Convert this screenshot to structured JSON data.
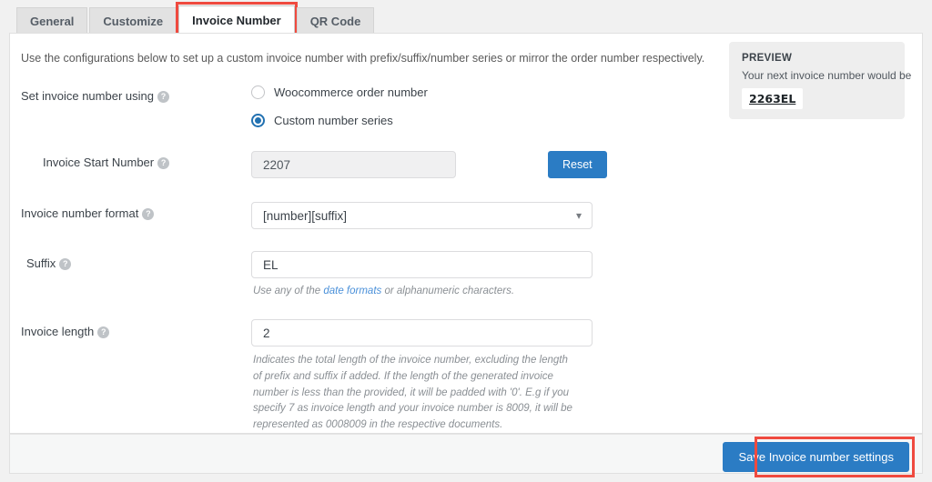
{
  "tabs": [
    {
      "label": "General",
      "active": false
    },
    {
      "label": "Customize",
      "active": false
    },
    {
      "label": "Invoice Number",
      "active": true
    },
    {
      "label": "QR Code",
      "active": false
    }
  ],
  "intro": "Use the configurations below to set up a custom invoice number with prefix/suffix/number series or mirror the order number respectively.",
  "preview": {
    "title": "PREVIEW",
    "subtitle": "Your next invoice number would be",
    "value": "2263EL"
  },
  "form": {
    "set_using": {
      "label": "Set invoice number using",
      "help_icon": "help-icon",
      "options": [
        {
          "label": "Woocommerce order number",
          "selected": false
        },
        {
          "label": "Custom number series",
          "selected": true
        }
      ]
    },
    "start_number": {
      "label": "Invoice Start Number",
      "value": "2207",
      "placeholder": "",
      "disabled": true,
      "reset_label": "Reset"
    },
    "number_format": {
      "label": "Invoice number format",
      "value": "[number][suffix]",
      "chevron_icon": "chevron-down-icon"
    },
    "suffix": {
      "label": "Suffix",
      "value": "EL",
      "placeholder": "",
      "hint_before": "Use any of the ",
      "hint_link": "date formats",
      "hint_after": " or alphanumeric characters."
    },
    "length": {
      "label": "Invoice length",
      "value": "2",
      "placeholder": "",
      "hint": "Indicates the total length of the invoice number, excluding the length of prefix and suffix if added. If the length of the generated invoice number is less than the provided, it will be padded with '0'. E.g if you specify 7 as invoice length and your invoice number is 8009, it will be represented as 0008009 in the respective documents."
    }
  },
  "footer": {
    "save_label": "Save Invoice number settings"
  },
  "colors": {
    "accent": "#2b7cc4",
    "annotation": "#ef4a3f",
    "radio_selected": "#2271b1",
    "link": "#4a90d9"
  }
}
